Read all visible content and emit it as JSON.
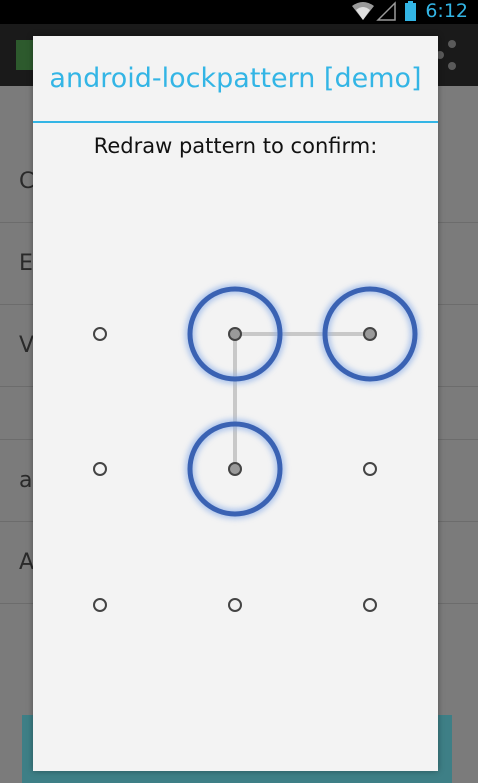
{
  "status_bar": {
    "time": "6:12",
    "icons": [
      "wifi-icon",
      "signal-icon",
      "battery-icon"
    ]
  },
  "background": {
    "rows": [
      {
        "label": "C"
      },
      {
        "label": "E"
      },
      {
        "label": "V"
      },
      {
        "label": ""
      },
      {
        "label": "a"
      },
      {
        "label": "A"
      }
    ]
  },
  "dialog": {
    "title": "android-lockpattern [demo]",
    "message": "Redraw pattern to confirm:"
  },
  "pattern": {
    "rows": 3,
    "cols": 3,
    "selected_cells": [
      1,
      2,
      4
    ],
    "connection_sequence": [
      2,
      1,
      4
    ],
    "colors": {
      "ring": "#3a62b3",
      "path": "#c8c8c8",
      "dot_fill": "#9a9a9a",
      "dot_stroke": "#444444"
    }
  },
  "colors": {
    "accent": "#33b5e5",
    "dialog_background": "#f3f3f3"
  }
}
